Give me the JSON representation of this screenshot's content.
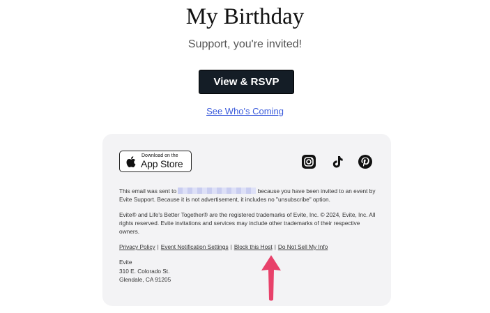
{
  "title": "My Birthday",
  "subtitle": "Support, you're invited!",
  "rsvp_button": "View & RSVP",
  "whos_coming_link": "See Who's Coming",
  "app_store": {
    "small": "Download on the",
    "big": "App Store"
  },
  "social_icons": [
    "instagram-icon",
    "tiktok-icon",
    "pinterest-icon"
  ],
  "notice": {
    "prefix": "This email was sent to",
    "suffix": "because you have been invited to an event by Evite Support. Because it is not advertisement, it includes no \"unsubscribe\" option."
  },
  "trademark": "Evite® and Life's Better Together® are the registered trademarks of Evite, Inc. © 2024, Evite, Inc. All rights reserved. Evite invitations and services may include other trademarks of their respective owners.",
  "links": {
    "privacy": "Privacy Policy",
    "notifications": "Event Notification Settings",
    "block": "Block this Host",
    "do_not_sell": "Do Not Sell My Info",
    "separator": "|"
  },
  "address": {
    "name": "Evite",
    "street": "310 E. Colorado St.",
    "city": "Glendale, CA 91205"
  },
  "colors": {
    "button": "#141d26",
    "link": "#3b5bdb",
    "footer_bg": "#f3f3f5",
    "annotation_arrow": "#e8416a"
  }
}
